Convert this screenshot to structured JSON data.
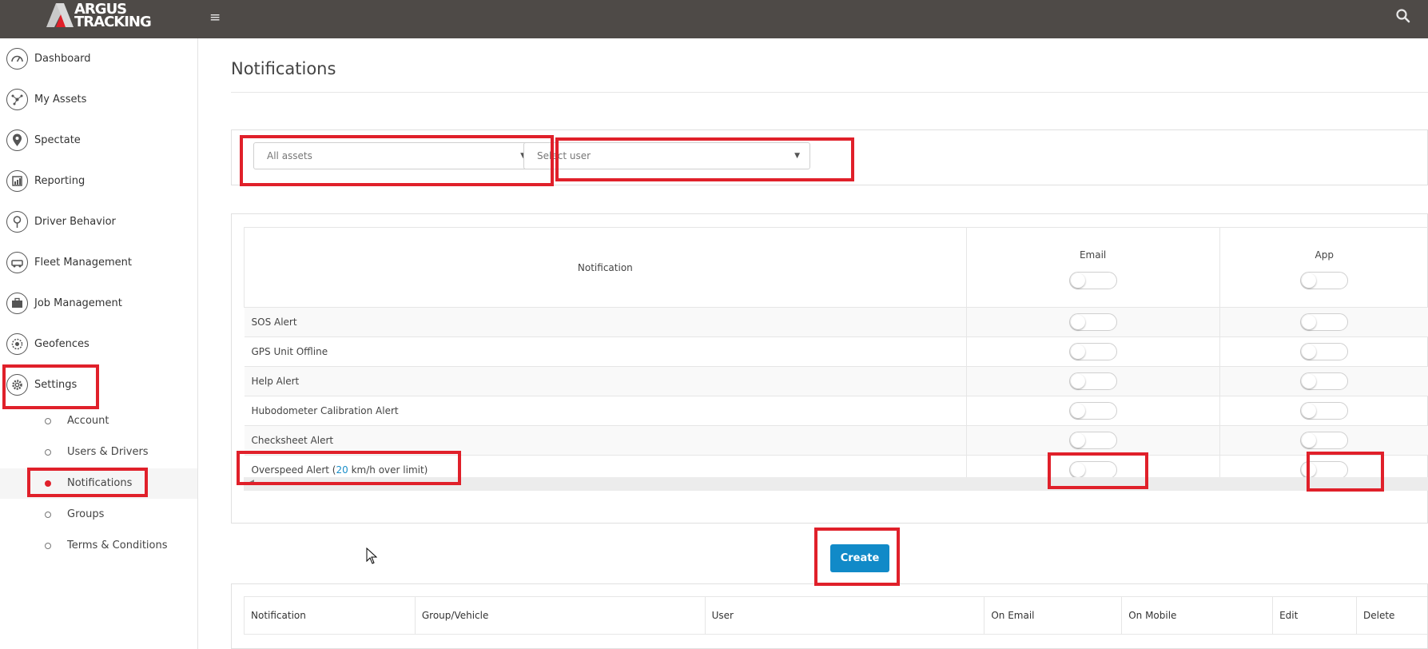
{
  "app": {
    "logo_line1": "ARGUS",
    "logo_line2": "TRACKING",
    "accent_color": "#118ac8",
    "highlight_color": "#e0202a"
  },
  "topbar": {
    "menu_icon": "hamburger-icon",
    "search_icon": "search-icon"
  },
  "sidebar": {
    "items": [
      {
        "label": "Dashboard",
        "icon": "dashboard-icon"
      },
      {
        "label": "My Assets",
        "icon": "assets-icon"
      },
      {
        "label": "Spectate",
        "icon": "map-pin-icon"
      },
      {
        "label": "Reporting",
        "icon": "report-icon"
      },
      {
        "label": "Driver Behavior",
        "icon": "driver-icon"
      },
      {
        "label": "Fleet Management",
        "icon": "fleet-icon"
      },
      {
        "label": "Job Management",
        "icon": "briefcase-icon"
      },
      {
        "label": "Geofences",
        "icon": "geofence-icon"
      },
      {
        "label": "Settings",
        "icon": "gear-icon"
      }
    ],
    "settings_sub": [
      {
        "label": "Account"
      },
      {
        "label": "Users & Drivers"
      },
      {
        "label": "Notifications",
        "active": true
      },
      {
        "label": "Groups"
      },
      {
        "label": "Terms & Conditions"
      }
    ]
  },
  "main": {
    "title": "Notifications",
    "filters": {
      "assets": "All assets",
      "user": "Select user"
    },
    "notif_table": {
      "col_notification": "Notification",
      "col_email": "Email",
      "col_app": "App",
      "rows": [
        {
          "name": "SOS Alert",
          "email": false,
          "app": false
        },
        {
          "name": "GPS Unit Offline",
          "email": false,
          "app": false
        },
        {
          "name": "Help Alert",
          "email": false,
          "app": false
        },
        {
          "name": "Hubodometer Calibration Alert",
          "email": false,
          "app": false
        },
        {
          "name": "Checksheet Alert",
          "email": false,
          "app": false
        }
      ],
      "overspeed": {
        "prefix": "Overspeed Alert (",
        "value": "20",
        "suffix": " km/h over limit)",
        "email": false,
        "app": false
      }
    },
    "create_label": "Create",
    "list_table": {
      "headers": [
        "Notification",
        "Group/Vehicle",
        "User",
        "On Email",
        "On Mobile",
        "Edit",
        "Delete"
      ]
    }
  }
}
